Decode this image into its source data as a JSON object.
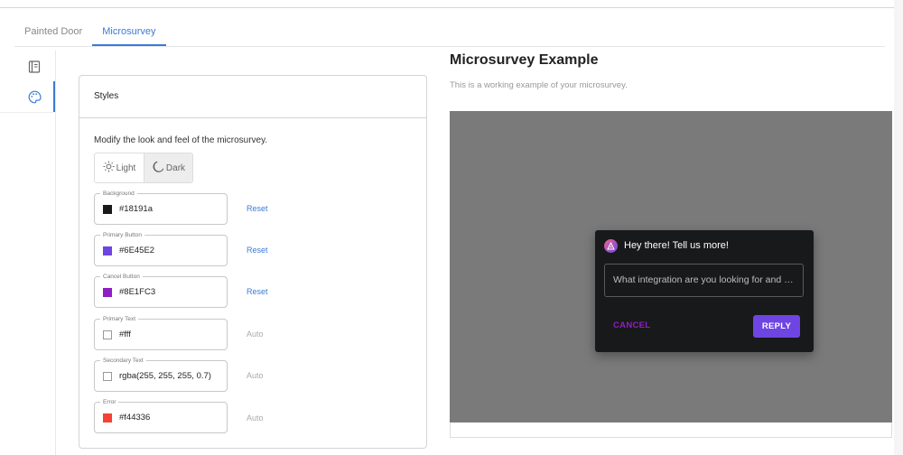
{
  "tabs": [
    {
      "label": "Painted Door"
    },
    {
      "label": "Microsurvey"
    }
  ],
  "sidebar": {
    "items": [
      {
        "icon": "book-icon"
      },
      {
        "icon": "palette-icon",
        "active": true
      }
    ]
  },
  "styles_panel": {
    "title": "Styles",
    "description": "Modify the look and feel of the microsurvey.",
    "theme_toggle": {
      "light_label": "Light",
      "dark_label": "Dark",
      "selected": "Dark"
    },
    "fields": [
      {
        "label": "Background",
        "value": "#18191a",
        "color": "#18191a",
        "action": "Reset"
      },
      {
        "label": "Primary Button",
        "value": "#6E45E2",
        "color": "#6E45E2",
        "action": "Reset"
      },
      {
        "label": "Cancel Button",
        "value": "#8E1FC3",
        "color": "#8E1FC3",
        "action": "Reset"
      },
      {
        "label": "Primary Text",
        "value": "#fff",
        "color": "#ffffff",
        "action": "Auto"
      },
      {
        "label": "Secondary Text",
        "value": "rgba(255, 255, 255, 0.7)",
        "color": "#ffffff",
        "action": "Auto"
      },
      {
        "label": "Error",
        "value": "#f44336",
        "color": "#f44336",
        "action": "Auto"
      }
    ]
  },
  "preview": {
    "title": "Microsurvey Example",
    "subtitle": "This is a working example of your microsurvey.",
    "survey": {
      "title": "Hey there! Tell us more!",
      "input_placeholder": "What integration are you looking for and why?",
      "cancel_label": "CANCEL",
      "reply_label": "REPLY"
    }
  },
  "colors": {
    "accent": "#3a7bd5",
    "preview_backdrop": "#7a7a7a"
  }
}
